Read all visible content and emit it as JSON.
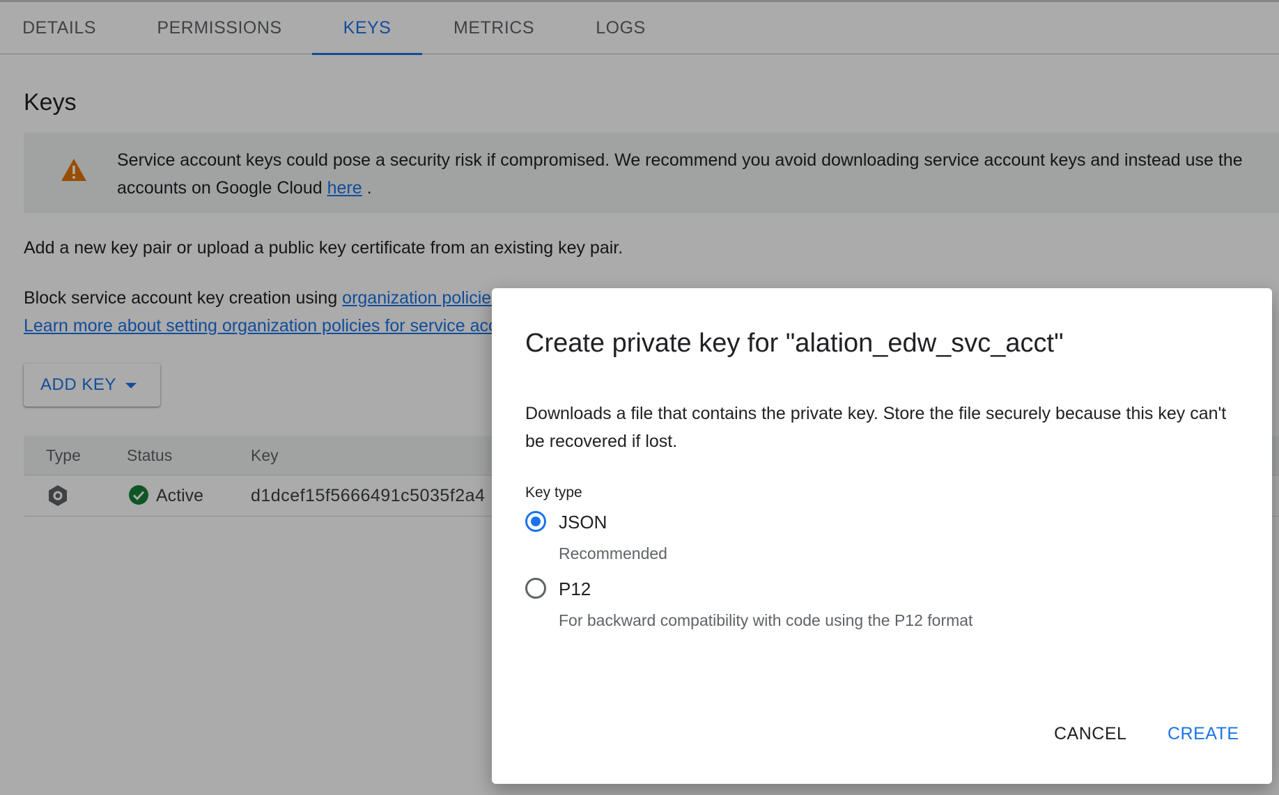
{
  "tabs": [
    {
      "label": "DETAILS",
      "active": false
    },
    {
      "label": "PERMISSIONS",
      "active": false
    },
    {
      "label": "KEYS",
      "active": true
    },
    {
      "label": "METRICS",
      "active": false
    },
    {
      "label": "LOGS",
      "active": false
    }
  ],
  "section_title": "Keys",
  "banner": {
    "icon": "warning-icon",
    "text_line1": "Service account keys could pose a security risk if compromised. We recommend you avoid downloading service account keys and instead use the",
    "text_line2_prefix": "accounts on Google Cloud ",
    "link": "here",
    "text_line2_suffix": " ."
  },
  "intro_text": "Add a new key pair or upload a public key certificate from an existing key pair.",
  "policy": {
    "prefix": "Block service account key creation using ",
    "link1": "organization policies",
    "link2": "Learn more about setting organization policies for service accounts"
  },
  "add_key_label": "ADD KEY",
  "table": {
    "headers": [
      "Type",
      "Status",
      "Key"
    ],
    "rows": [
      {
        "type_icon": "service-account-key-icon",
        "status": "Active",
        "key": "d1dcef15f5666491c5035f2a4"
      }
    ]
  },
  "dialog": {
    "title": "Create private key for \"alation_edw_svc_acct\"",
    "description": "Downloads a file that contains the private key. Store the file securely because this key can't be recovered if lost.",
    "key_type_label": "Key type",
    "options": [
      {
        "label": "JSON",
        "sub": "Recommended",
        "checked": true
      },
      {
        "label": "P12",
        "sub": "For backward compatibility with code using the P12 format",
        "checked": false
      }
    ],
    "cancel_label": "CANCEL",
    "create_label": "CREATE"
  },
  "colors": {
    "accent": "#1a73e8",
    "success": "#188038",
    "warning": "#e37400"
  }
}
